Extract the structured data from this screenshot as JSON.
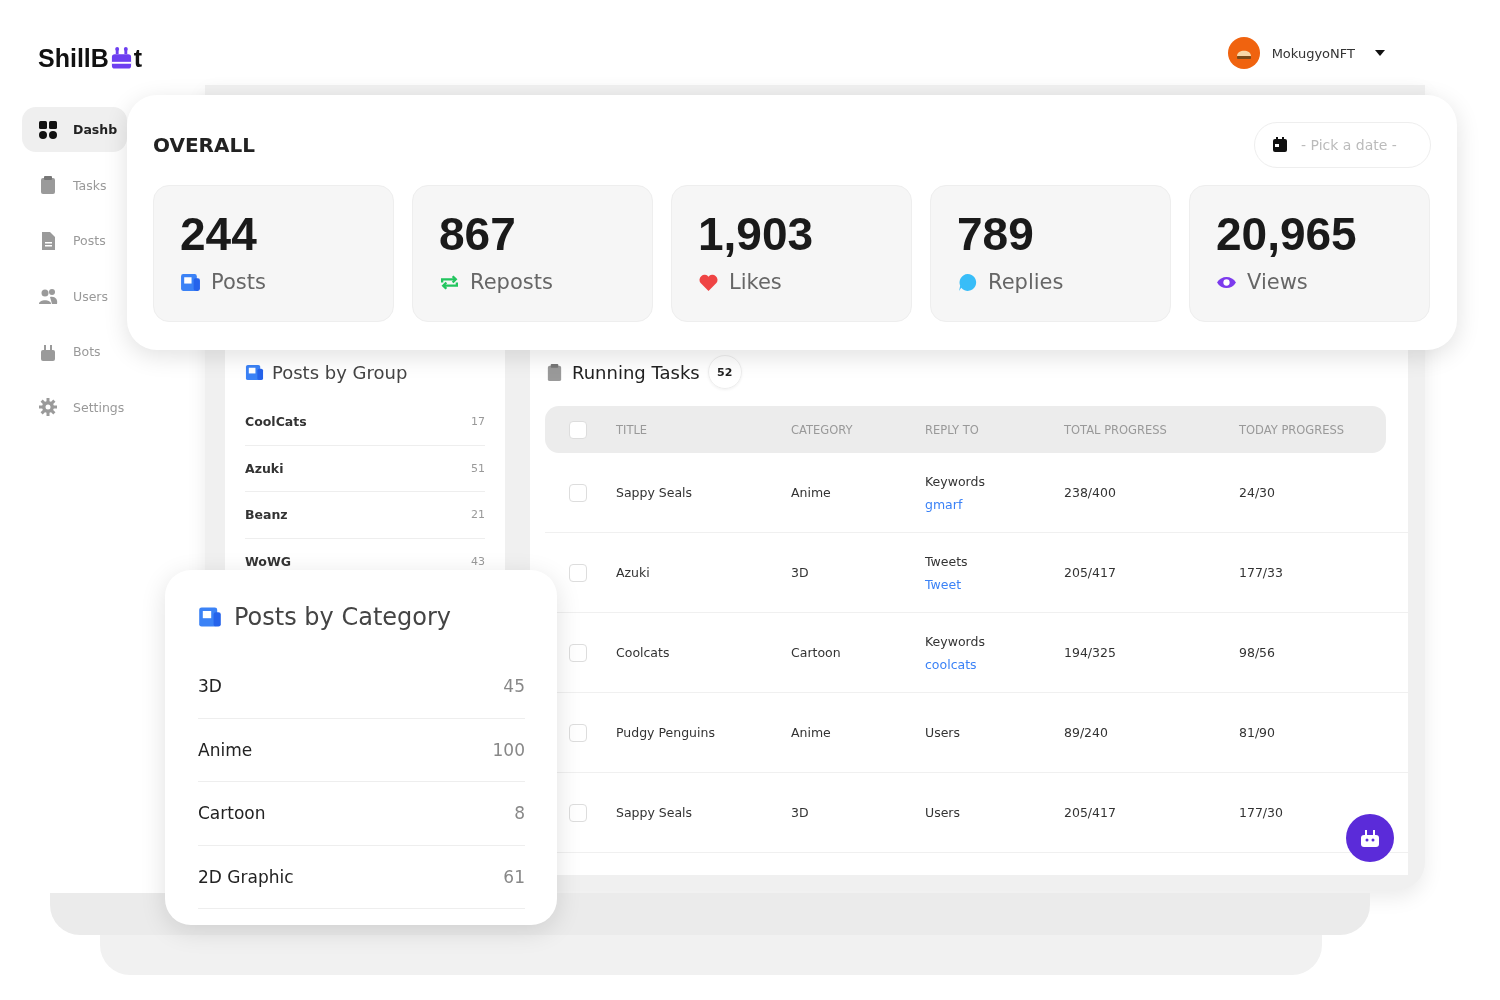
{
  "logo": {
    "before": "ShillB",
    "after": "t"
  },
  "user": {
    "name": "MokugyoNFT"
  },
  "sidebar": {
    "items": [
      {
        "label": "Dashb",
        "selected": true
      },
      {
        "label": "Tasks",
        "selected": false
      },
      {
        "label": "Posts",
        "selected": false
      },
      {
        "label": "Users",
        "selected": false
      },
      {
        "label": "Bots",
        "selected": false
      },
      {
        "label": "Settings",
        "selected": false
      }
    ]
  },
  "overall": {
    "title": "OVERALL",
    "date_picker": {
      "placeholder": "- Pick a date -"
    },
    "stats": [
      {
        "value": "244",
        "label": "Posts"
      },
      {
        "value": "867",
        "label": "Reposts"
      },
      {
        "value": "1,903",
        "label": "Likes"
      },
      {
        "value": "789",
        "label": "Replies"
      },
      {
        "value": "20,965",
        "label": "Views"
      }
    ]
  },
  "posts_by_group": {
    "title": "Posts by Group",
    "rows": [
      {
        "name": "CoolCats",
        "count": "17"
      },
      {
        "name": "Azuki",
        "count": "51"
      },
      {
        "name": "Beanz",
        "count": "21"
      },
      {
        "name": "WoWG",
        "count": "43"
      }
    ]
  },
  "running_tasks": {
    "title": "Running Tasks",
    "count": "52",
    "header_checked": false,
    "columns": [
      "TITLE",
      "CATEGORY",
      "REPLY TO",
      "TOTAL PROGRESS",
      "TODAY PROGRESS"
    ],
    "rows": [
      {
        "checked": false,
        "title": "Sappy Seals",
        "category": "Anime",
        "reply_to": "Keywords",
        "reply_link": "gmarf",
        "total": "238/400",
        "today": "24/30"
      },
      {
        "checked": false,
        "title": "Azuki",
        "category": "3D",
        "reply_to": "Tweets",
        "reply_link": "Tweet",
        "total": "205/417",
        "today": "177/33"
      },
      {
        "checked": false,
        "title": "Coolcats",
        "category": "Cartoon",
        "reply_to": "Keywords",
        "reply_link": "coolcats",
        "total": "194/325",
        "today": "98/56"
      },
      {
        "checked": false,
        "title": "Pudgy Penguins",
        "category": "Anime",
        "reply_to": "Users",
        "total": "89/240",
        "today": "81/90"
      },
      {
        "checked": false,
        "title": "Sappy Seals",
        "category": "3D",
        "reply_to": "Users",
        "total": "205/417",
        "today": "177/30"
      }
    ]
  },
  "posts_by_category": {
    "title": "Posts by Category",
    "rows": [
      {
        "name": "3D",
        "count": "45"
      },
      {
        "name": "Anime",
        "count": "100"
      },
      {
        "name": "Cartoon",
        "count": "8"
      },
      {
        "name": "2D Graphic",
        "count": "61"
      }
    ]
  }
}
